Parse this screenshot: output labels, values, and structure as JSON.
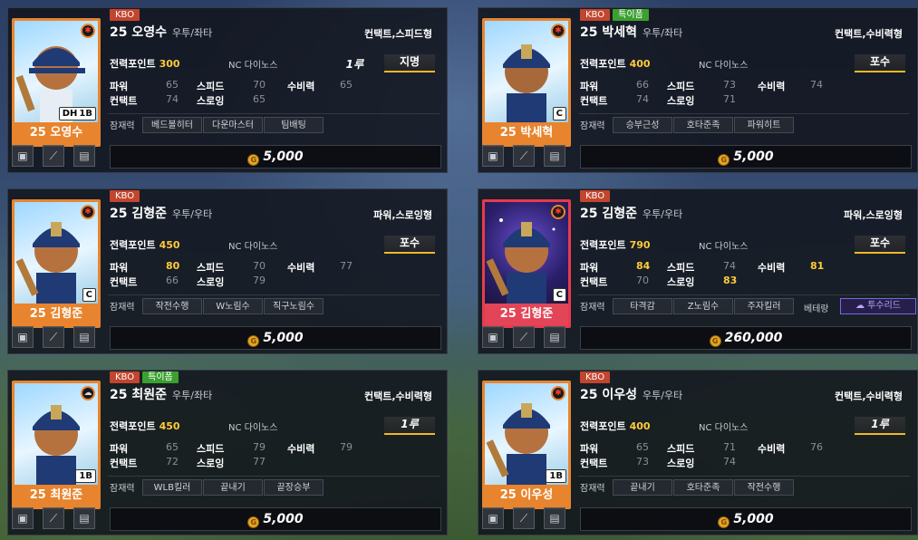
{
  "colors": {
    "accent_orange": "#e8842d",
    "accent_red": "#e24558",
    "highlight_stat": "#ffcb3a",
    "kbo_tag": "#c2452e",
    "special_tag": "#3aa02f"
  },
  "labels": {
    "points": "전력포인트",
    "power": "파워",
    "speed": "스피드",
    "defense": "수비력",
    "contact": "컨택트",
    "throwing": "스로잉",
    "potential": "잠재력",
    "veteran": "베테랑"
  },
  "cards": [
    {
      "tags": [
        "KBO"
      ],
      "year": "25",
      "name": "오영수",
      "hand": "우투/좌타",
      "style": "컨택트,스피드형",
      "points": "300",
      "team": "NC 다이노스",
      "role_secondary": "1루",
      "role": "지명",
      "pos_badge": "1B",
      "pos_prefix": "DH",
      "nameplate": "25 오영수",
      "corner_icon": "star",
      "stats": {
        "power": "65",
        "speed": "70",
        "defense": "65",
        "contact": "74",
        "throwing": "65"
      },
      "potentials": [
        "베드볼히터",
        "다운마스터",
        "팀배팅"
      ],
      "price": "5,000"
    },
    {
      "tags": [
        "KBO",
        "특이폼"
      ],
      "year": "25",
      "name": "박세혁",
      "hand": "우투/좌타",
      "style": "컨택트,수비력형",
      "points": "400",
      "team": "NC 다이노스",
      "role": "포수",
      "pos_badge": "C",
      "nameplate": "25 박세혁",
      "corner_icon": "star",
      "stats": {
        "power": "66",
        "speed": "73",
        "defense": "74",
        "contact": "74",
        "throwing": "71"
      },
      "potentials": [
        "승부근성",
        "호타준족",
        "파워히트"
      ],
      "price": "5,000"
    },
    {
      "tags": [
        "KBO"
      ],
      "year": "25",
      "name": "김형준",
      "hand": "우투/우타",
      "style": "파워,스로잉형",
      "points": "450",
      "team": "NC 다이노스",
      "role": "포수",
      "pos_badge": "C",
      "nameplate": "25 김형준",
      "corner_icon": "star",
      "stats": {
        "power": "80",
        "speed": "70",
        "defense": "77",
        "contact": "66",
        "throwing": "79"
      },
      "potentials": [
        "작전수행",
        "W노림수",
        "직구노림수"
      ],
      "price": "5,000"
    },
    {
      "tags": [
        "KBO"
      ],
      "year": "25",
      "name": "김형준",
      "hand": "우투/우타",
      "style": "파워,스로잉형",
      "points": "790",
      "team": "NC 다이노스",
      "role": "포수",
      "pos_badge": "C",
      "nameplate": "25 김형준",
      "corner_icon": "star",
      "stats": {
        "power": "84",
        "speed": "74",
        "defense": "81",
        "contact": "70",
        "throwing": "83"
      },
      "potentials": [
        "타격감",
        "Z노림수",
        "주자킬러"
      ],
      "veteran_value": "투수리드",
      "price": "260,000"
    },
    {
      "tags": [
        "KBO",
        "특이폼"
      ],
      "year": "25",
      "name": "최원준",
      "hand": "우투/좌타",
      "style": "컨택트,수비력형",
      "points": "450",
      "team": "NC 다이노스",
      "role_secondary": "1루",
      "pos_badge": "1B",
      "nameplate": "25 최원준",
      "corner_icon": "cloud",
      "stats": {
        "power": "65",
        "speed": "79",
        "defense": "79",
        "contact": "72",
        "throwing": "77"
      },
      "potentials": [
        "WLB킬러",
        "끝내기",
        "끝장승부"
      ],
      "price": "5,000"
    },
    {
      "tags": [
        "KBO"
      ],
      "year": "25",
      "name": "이우성",
      "hand": "우투/우타",
      "style": "컨택트,수비력형",
      "points": "400",
      "team": "NC 다이노스",
      "role_secondary": "1루",
      "pos_badge": "1B",
      "nameplate": "25 이우성",
      "corner_icon": "star",
      "stats": {
        "power": "65",
        "speed": "71",
        "defense": "76",
        "contact": "73",
        "throwing": "74"
      },
      "potentials": [
        "끝내기",
        "호타준족",
        "작전수행"
      ],
      "price": "5,000"
    }
  ]
}
